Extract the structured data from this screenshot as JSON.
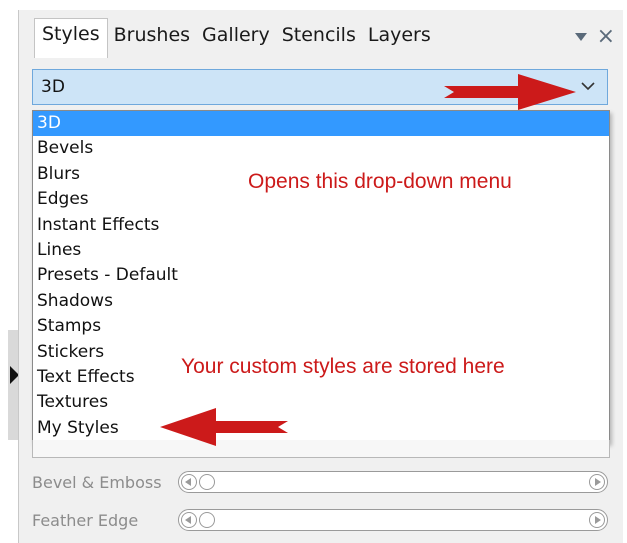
{
  "tabs": [
    {
      "label": "Styles",
      "active": true
    },
    {
      "label": "Brushes",
      "active": false
    },
    {
      "label": "Gallery",
      "active": false
    },
    {
      "label": "Stencils",
      "active": false
    },
    {
      "label": "Layers",
      "active": false
    }
  ],
  "panel_controls": {
    "menu_icon": "triangle-down-icon",
    "close_icon": "close-icon",
    "close_glyph": "×"
  },
  "category_select": {
    "selected": "3D",
    "icon": "chevron-down-icon"
  },
  "category_options": [
    "3D",
    "Bevels",
    "Blurs",
    "Edges",
    "Instant Effects",
    "Lines",
    "Presets - Default",
    "Shadows",
    "Stamps",
    "Stickers",
    "Text Effects",
    "Textures",
    "My Styles"
  ],
  "annotations": {
    "opens_menu": "Opens this drop-down menu",
    "custom_styles": "Your custom styles are stored here"
  },
  "sliders": [
    {
      "label": "Bevel & Emboss"
    },
    {
      "label": "Feather Edge"
    }
  ],
  "colors": {
    "annotation_red": "#cc1a1a",
    "selection_blue": "#3399ff",
    "select_background": "#cde4f7"
  }
}
